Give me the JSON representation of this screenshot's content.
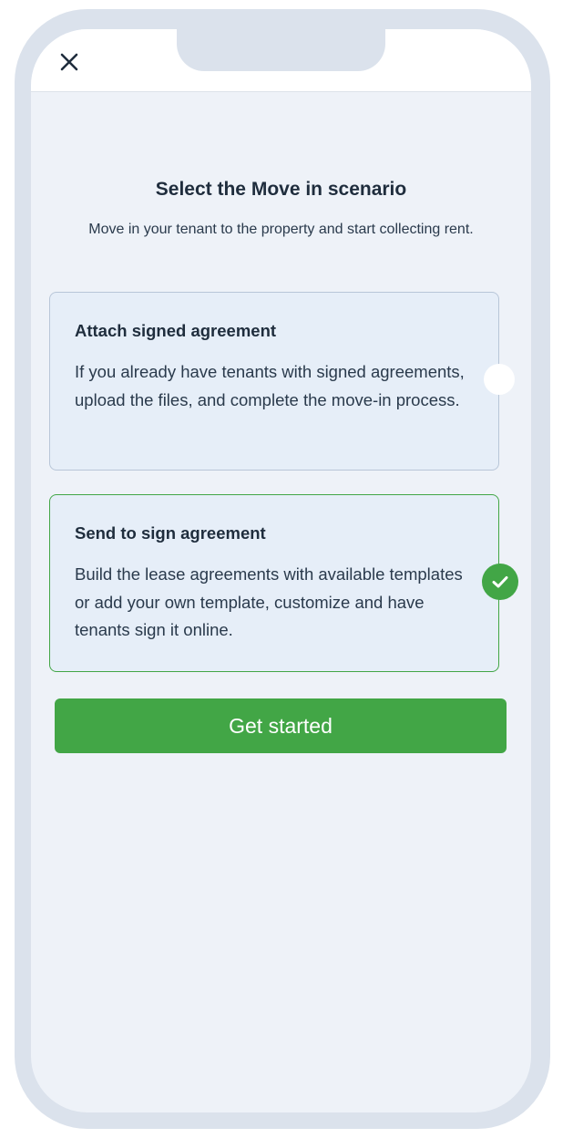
{
  "header": {
    "close_icon": "close-icon"
  },
  "main": {
    "title": "Select the Move in scenario",
    "subtitle": "Move in your tenant to the property and start collecting rent."
  },
  "options": [
    {
      "title": "Attach signed agreement",
      "description": "If you already have tenants with signed agreements, upload the files, and complete the move-in process.",
      "selected": false
    },
    {
      "title": "Send to sign agreement",
      "description": "Build the lease agreements with available templates or add your own template, customize and have tenants sign it online.",
      "selected": true
    }
  ],
  "actions": {
    "get_started_label": "Get started"
  },
  "colors": {
    "accent": "#42a646",
    "frame": "#dbe2ec",
    "screen_bg": "#eef2f8",
    "card_bg": "#e6eef8",
    "text": "#1f2d3d"
  }
}
